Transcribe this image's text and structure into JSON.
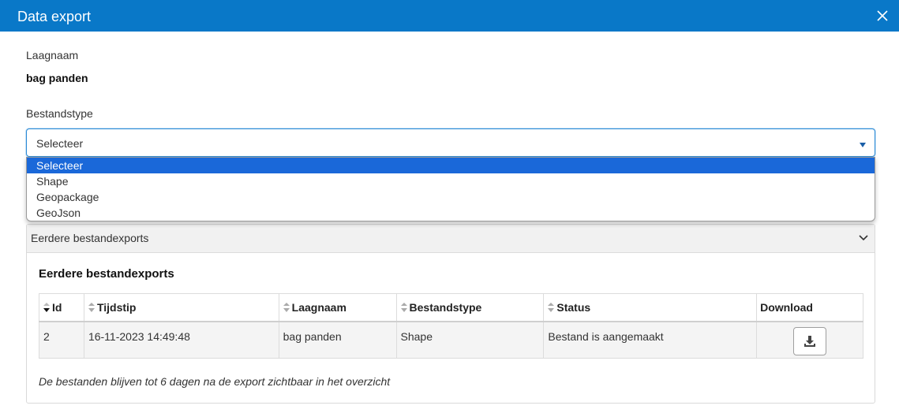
{
  "dialog": {
    "title": "Data export"
  },
  "layer": {
    "label": "Laagnaam",
    "value": "bag panden"
  },
  "filetype": {
    "label": "Bestandstype",
    "selected": "Selecteer",
    "options": [
      "Selecteer",
      "Shape",
      "Geopackage",
      "GeoJson"
    ]
  },
  "previous_exports": {
    "panel_title": "Eerdere bestandexports",
    "section_title": "Eerdere bestandexports",
    "columns": [
      "Id",
      "Tijdstip",
      "Laagnaam",
      "Bestandstype",
      "Status",
      "Download"
    ],
    "rows": [
      {
        "id": "2",
        "time": "16-11-2023 14:49:48",
        "layer": "bag panden",
        "type": "Shape",
        "status": "Bestand is aangemaakt"
      }
    ],
    "footnote": "De bestanden blijven tot 6 dagen na de export zichtbaar in het overzicht"
  },
  "icons": {
    "close": "close-icon",
    "dropdown_arrow": "caret-down-icon",
    "panel_chevron": "chevron-down-icon",
    "sort": "sort-icon",
    "download": "download-icon"
  },
  "colors": {
    "header": "#0978c8",
    "selected_option": "#1a68d9",
    "focus_border": "#2b8ad6"
  }
}
